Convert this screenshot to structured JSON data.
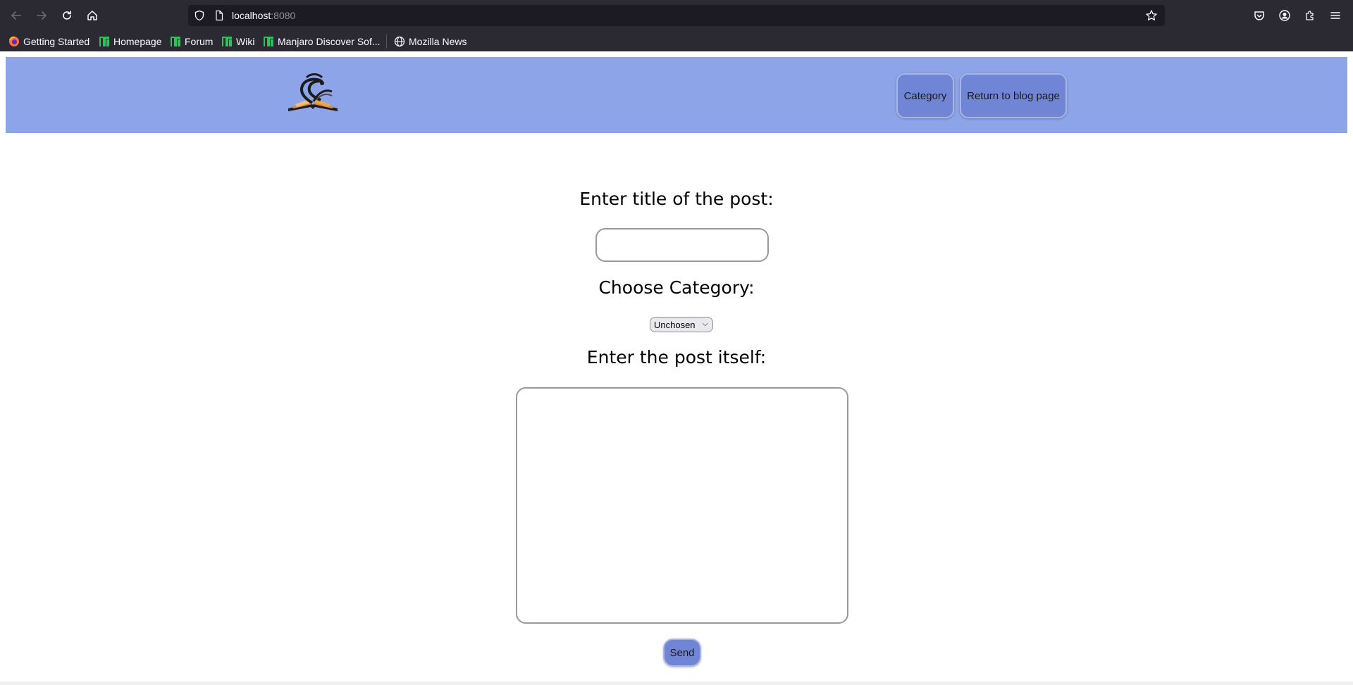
{
  "browser": {
    "url_host": "localhost",
    "url_port": ":8080",
    "bookmarks": [
      {
        "label": "Getting Started",
        "icon": "firefox-icon"
      },
      {
        "label": "Homepage",
        "icon": "manjaro-icon"
      },
      {
        "label": "Forum",
        "icon": "manjaro-icon"
      },
      {
        "label": "Wiki",
        "icon": "manjaro-icon"
      },
      {
        "label": "Manjaro Discover Sof...",
        "icon": "manjaro-icon"
      },
      {
        "label": "Mozilla News",
        "icon": "globe-icon"
      }
    ]
  },
  "header": {
    "nav": {
      "category_label": "Category",
      "return_label": "Return to blog page"
    },
    "color": "#8da5e8",
    "button_color": "#7085d6"
  },
  "form": {
    "title_label": "Enter title of the post:",
    "title_value": "",
    "category_label": "Choose Category:",
    "category_selected": "Unchosen",
    "post_label": "Enter the post itself:",
    "post_value": "",
    "send_label": "Send"
  }
}
